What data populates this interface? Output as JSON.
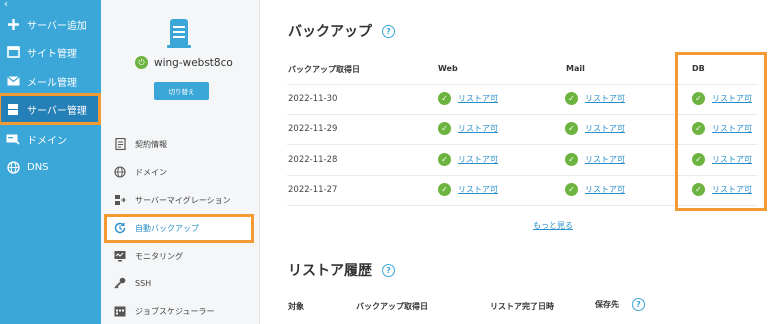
{
  "leftnav": {
    "collapse_glyph": "‹",
    "items": [
      {
        "label": "サーバー追加",
        "icon": "plus-icon"
      },
      {
        "label": "サイト管理",
        "icon": "window-icon"
      },
      {
        "label": "メール管理",
        "icon": "envelope-icon"
      },
      {
        "label": "サーバー管理",
        "icon": "server-icon"
      },
      {
        "label": "ドメイン",
        "icon": "domain-card-icon"
      },
      {
        "label": "DNS",
        "icon": "globe-icon"
      }
    ]
  },
  "server": {
    "name": "wing-webst8co",
    "switch_label": "切り替え"
  },
  "menu": {
    "items": [
      {
        "label": "契約情報",
        "icon": "document-icon"
      },
      {
        "label": "ドメイン",
        "icon": "globe-icon"
      },
      {
        "label": "サーバーマイグレーション",
        "icon": "migration-icon"
      },
      {
        "label": "自動バックアップ",
        "icon": "backup-icon"
      },
      {
        "label": "モニタリング",
        "icon": "monitor-icon"
      },
      {
        "label": "SSH",
        "icon": "key-icon"
      },
      {
        "label": "ジョブスケジューラー",
        "icon": "schedule-icon"
      }
    ]
  },
  "backup": {
    "title": "バックアップ",
    "headers": {
      "date": "バックアップ取得日",
      "web": "Web",
      "mail": "Mail",
      "db": "DB"
    },
    "rows": [
      {
        "date": "2022-11-30",
        "web": "リストア可",
        "mail": "リストア可",
        "db": "リストア可"
      },
      {
        "date": "2022-11-29",
        "web": "リストア可",
        "mail": "リストア可",
        "db": "リストア可"
      },
      {
        "date": "2022-11-28",
        "web": "リストア可",
        "mail": "リストア可",
        "db": "リストア可"
      },
      {
        "date": "2022-11-27",
        "web": "リストア可",
        "mail": "リストア可",
        "db": "リストア可"
      }
    ],
    "more": "もっと見る"
  },
  "restore": {
    "title": "リストア履歴",
    "headers": {
      "target": "対象",
      "backup_date": "バックアップ取得日",
      "done": "リストア完了日時",
      "dest": "保存先"
    }
  },
  "colors": {
    "nav": "#3aa7d8",
    "highlight": "#f39a33",
    "ok": "#6db33f",
    "link": "#2a8fc9"
  }
}
